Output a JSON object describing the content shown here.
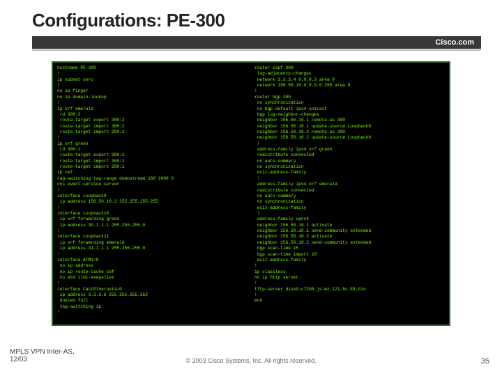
{
  "slide": {
    "title": "Configurations: PE-300",
    "brand": "Cisco.com"
  },
  "config": {
    "left": "hostname PE-300\n!\nip subnet-zero\n!\nno ip finger\nno ip domain-lookup\n!\nip vrf emerald\n rd 300:2\n route-target export 300:2\n route-target import 300:2\n route-target import 200:2\n!\nip vrf green\n rd 300:1\n route-target export 300:1\n route-target import 300:1\n route-target import 200:1\nip cef\ntag-switching tag-range downstream 160 1000 0\ncns event-service server\n!\ninterface Loopback0\n ip address 156.50.10.3 255.255.255.255\n!\ninterface Loopback10\n ip vrf forwarding green\n ip address 30.1.1.1 255.255.255.0\n!\ninterface Loopback11\n ip vrf forwarding emerald\n ip address 31.1.1.1 255.255.255.0\n!\ninterface ATM1/0\n no ip address\n no ip route-cache cef\n no atm ilmi-keepalive\n!\ninterface FastEthernet4/0\n ip address 3.3.3.6 255.255.255.252\n duplex full\n tag-switching ip\n!",
    "right": "router ospf 300\n log-adjacency-changes\n network 3.3.3.4 0.0.0.3 area 0\n network 156.50.10.0 0.0.0.255 area 0\n!\nrouter bgp 300\n no synchronization\n no bgp default ipv4-unicast\n bgp log-neighbor-changes\n neighbor 156.50.10.1 remote-as 300\n neighbor 156.50.10.1 update-source Loopback0\n neighbor 156.50.10.2 remote-as 300\n neighbor 156.50.10.2 update-source Loopback0\n !\n address-family ipv4 vrf green\n redistribute connected\n no auto-summary\n no synchronization\n exit-address-family\n !\n address-family ipv4 vrf emerald\n redistribute connected\n no auto-summary\n no synchronization\n exit-address-family\n !\n address-family vpnv4\n neighbor 156.50.10.1 activate\n neighbor 156.50.10.1 send-community extended\n neighbor 156.50.10.2 activate\n neighbor 156.50.10.2 send-community extended\n bgp scan-time 15\n bgp scan-time import 10\n exit-address-family\n!\nip classless\nno ip http server\n!\ntftp-server disk0:c7200-js-mz.121-5c.E8.bin\n!\nend"
  },
  "footer": {
    "leftLine1": "MPLS VPN Inter-AS,",
    "leftLine2": "12/03",
    "center": "© 2003 Cisco Systems, Inc. All rights reserved.",
    "pageNumber": "35"
  }
}
